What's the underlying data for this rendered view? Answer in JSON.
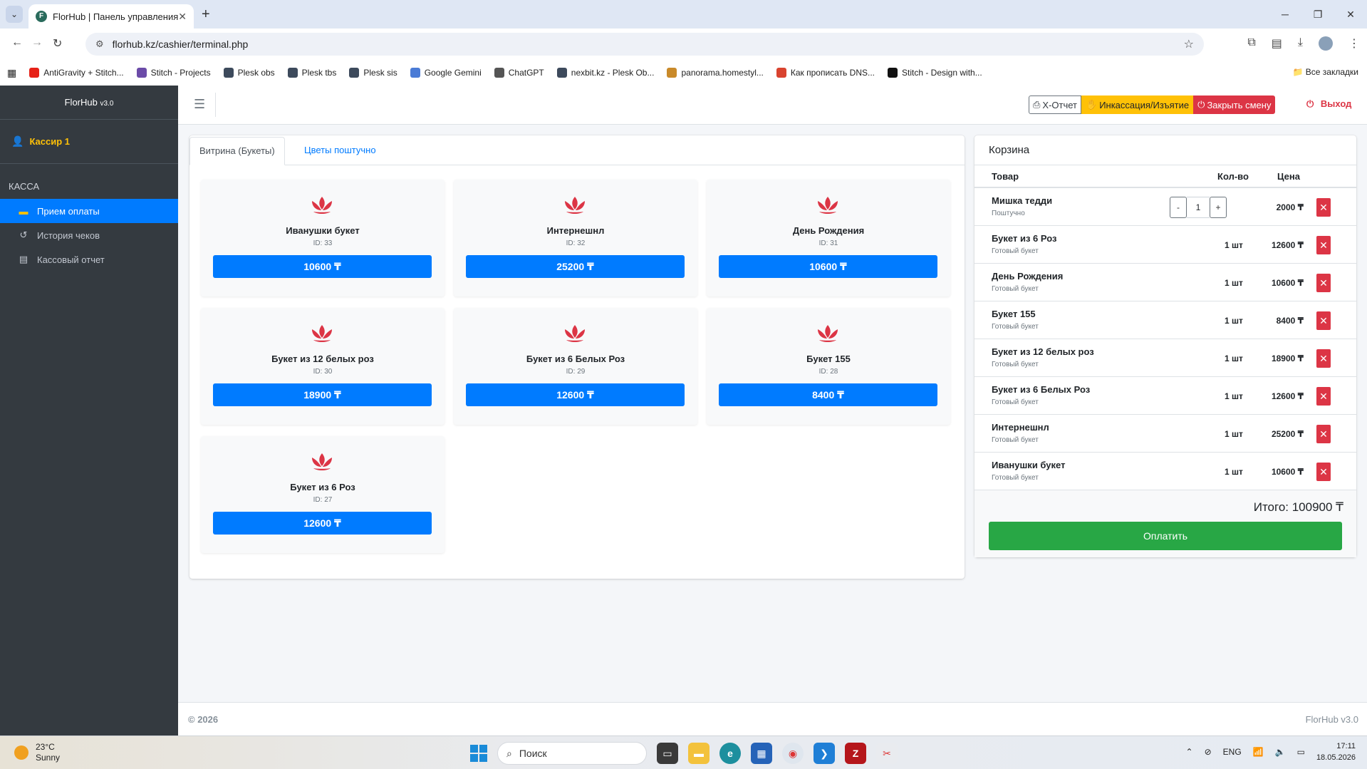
{
  "browser": {
    "tab_title": "FlorHub | Панель управления",
    "url": "florhub.kz/cashier/terminal.php",
    "bookmarks": [
      {
        "label": "AntiGravity + Stitch...",
        "color": "#e62117",
        "icon": "youtube-icon"
      },
      {
        "label": "Stitch - Projects",
        "color": "#6b4ba8",
        "icon": "stitch-icon"
      },
      {
        "label": "Plesk obs",
        "color": "#3d4a5c",
        "icon": "plesk-icon"
      },
      {
        "label": "Plesk tbs",
        "color": "#3d4a5c",
        "icon": "plesk-icon"
      },
      {
        "label": "Plesk sis",
        "color": "#3d4a5c",
        "icon": "plesk-icon"
      },
      {
        "label": "Google Gemini",
        "color": "#4a7bd6",
        "icon": "gemini-icon"
      },
      {
        "label": "ChatGPT",
        "color": "#555555",
        "icon": "chatgpt-icon"
      },
      {
        "label": "nexbit.kz - Plesk Ob...",
        "color": "#3d4a5c",
        "icon": "plesk-icon"
      },
      {
        "label": "panorama.homestyl...",
        "color": "#c98a2a",
        "icon": "panorama-icon"
      },
      {
        "label": "Как прописать DNS...",
        "color": "#d9432f",
        "icon": "chrome-icon"
      },
      {
        "label": "Stitch - Design with...",
        "color": "#111111",
        "icon": "stitch-design-icon"
      }
    ],
    "all_bookmarks": "Все закладки"
  },
  "sidebar": {
    "brand_main": "FlorHub",
    "brand_ver": "v3.0",
    "user": "Кассир 1",
    "section": "КАССА",
    "items": [
      {
        "label": "Прием оплаты",
        "active": true
      },
      {
        "label": "История чеков",
        "active": false
      },
      {
        "label": "Кассовый отчет",
        "active": false
      }
    ]
  },
  "topbar": {
    "x_report": "X-Отчет",
    "incass": "Инкассация/Изъятие",
    "close_shift": "Закрыть смену",
    "exit": "Выход"
  },
  "showcase": {
    "tab_active": "Витрина (Букеты)",
    "tab_other": "Цветы поштучно",
    "products": [
      {
        "name": "Иванушки букет",
        "id": "ID: 33",
        "price": "10600 ₸"
      },
      {
        "name": "Интернешнл",
        "id": "ID: 32",
        "price": "25200 ₸"
      },
      {
        "name": "День Рождения",
        "id": "ID: 31",
        "price": "10600 ₸"
      },
      {
        "name": "Букет из 12 белых роз",
        "id": "ID: 30",
        "price": "18900 ₸"
      },
      {
        "name": "Букет из 6 Белых Роз",
        "id": "ID: 29",
        "price": "12600 ₸"
      },
      {
        "name": "Букет 155",
        "id": "ID: 28",
        "price": "8400 ₸"
      },
      {
        "name": "Букет из 6 Роз",
        "id": "ID: 27",
        "price": "12600 ₸"
      }
    ],
    "accent": "#007bff",
    "flower_color": "#dc3545"
  },
  "cart": {
    "title": "Корзина",
    "col_item": "Товар",
    "col_qty": "Кол-во",
    "col_price": "Цена",
    "rows": [
      {
        "name": "Мишка тедди",
        "sub": "Поштучно",
        "qty": "1",
        "price": "2000 ₸",
        "stepper": true
      },
      {
        "name": "Букет из 6 Роз",
        "sub": "Готовый букет",
        "qty": "1 шт",
        "price": "12600 ₸"
      },
      {
        "name": "День Рождения",
        "sub": "Готовый букет",
        "qty": "1 шт",
        "price": "10600 ₸"
      },
      {
        "name": "Букет 155",
        "sub": "Готовый букет",
        "qty": "1 шт",
        "price": "8400 ₸"
      },
      {
        "name": "Букет из 12 белых роз",
        "sub": "Готовый букет",
        "qty": "1 шт",
        "price": "18900 ₸"
      },
      {
        "name": "Букет из 6 Белых Роз",
        "sub": "Готовый букет",
        "qty": "1 шт",
        "price": "12600 ₸"
      },
      {
        "name": "Интернешнл",
        "sub": "Готовый букет",
        "qty": "1 шт",
        "price": "25200 ₸"
      },
      {
        "name": "Иванушки букет",
        "sub": "Готовый букет",
        "qty": "1 шт",
        "price": "10600 ₸"
      }
    ],
    "minus": "-",
    "plus": "+",
    "total": "Итого: 100900 ₸",
    "pay": "Оплатить"
  },
  "footer": {
    "copyright": "© 2026",
    "version": "FlorHub v3.0"
  },
  "taskbar": {
    "temp": "23°C",
    "weather": "Sunny",
    "search": "Поиск",
    "lang": "ENG",
    "time": "17:11",
    "date": "18.05.2026"
  }
}
